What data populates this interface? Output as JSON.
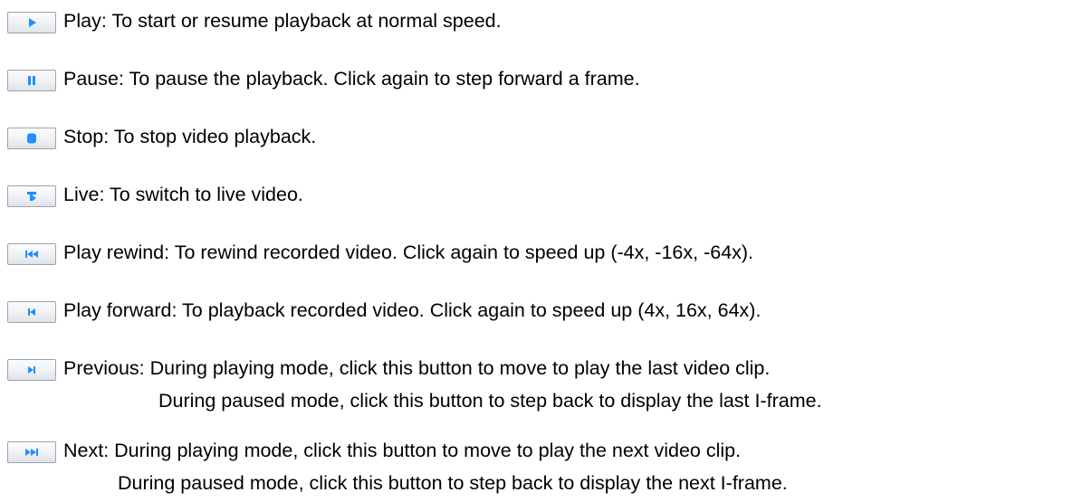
{
  "accent_color": "#1e90ff",
  "controls": [
    {
      "icon": "play-icon",
      "label": "Play: To start or resume playback at normal speed."
    },
    {
      "icon": "pause-icon",
      "label": "Pause: To pause the playback. Click again to step forward a frame."
    },
    {
      "icon": "stop-icon",
      "label": "Stop: To stop video playback."
    },
    {
      "icon": "live-icon",
      "label": "Live: To switch to live video."
    },
    {
      "icon": "rewind-icon",
      "label": "Play rewind: To rewind recorded video. Click again to speed up (-4x, -16x, -64x)."
    },
    {
      "icon": "play-forward-icon",
      "label": "Play forward: To playback recorded video. Click again to speed up (4x, 16x, 64x)."
    },
    {
      "icon": "previous-icon",
      "label": "Previous: During playing mode, click this button to move to play the last video clip.",
      "continuation": "During paused mode, click this button to step back to display the last I-frame."
    },
    {
      "icon": "next-icon",
      "label": "Next: During playing mode, click this button to move to play the next video clip.",
      "continuation": "During paused mode, click this button to step back to display the next I-frame."
    }
  ]
}
